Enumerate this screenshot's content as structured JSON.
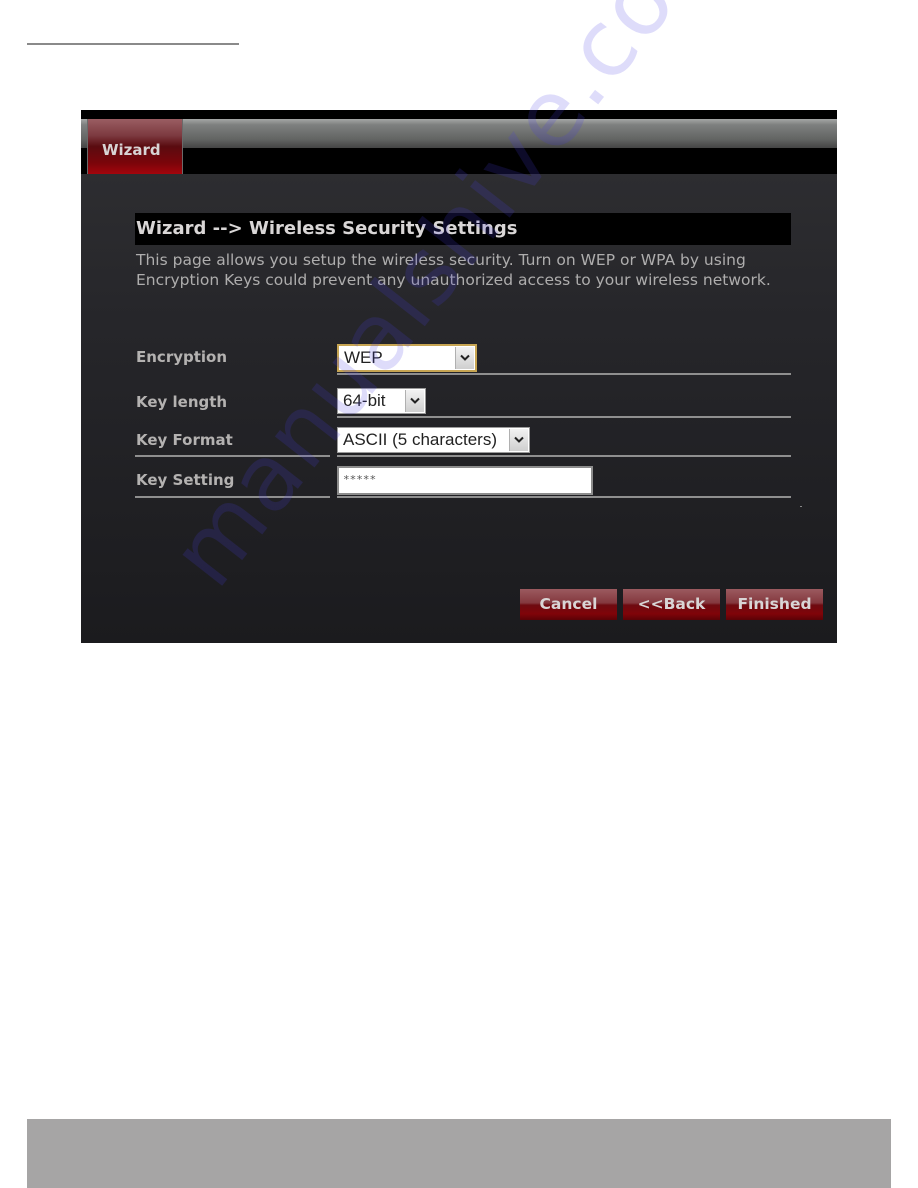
{
  "page": {
    "tab": {
      "label": "Wizard"
    },
    "section_title": "Wizard --> Wireless Security Settings",
    "description": "This page allows you setup the wireless security. Turn on WEP or WPA by using Encryption Keys could prevent any unauthorized access to your wireless network.",
    "fields": {
      "encryption": {
        "label": "Encryption",
        "value": "WEP"
      },
      "key_length": {
        "label": "Key length",
        "value": "64-bit"
      },
      "key_format": {
        "label": "Key Format",
        "value": "ASCII (5 characters)"
      },
      "key_setting": {
        "label": "Key Setting",
        "value": "*****"
      }
    },
    "buttons": {
      "cancel": "Cancel",
      "back": "<<Back",
      "finished": "Finished"
    }
  },
  "watermark": "manualshive.com",
  "icons": {
    "dropdown": "chevron-down-icon"
  },
  "colors": {
    "accent_red": "#8a050b",
    "focus_border": "#c6a452",
    "panel_bg": "#26262a"
  }
}
